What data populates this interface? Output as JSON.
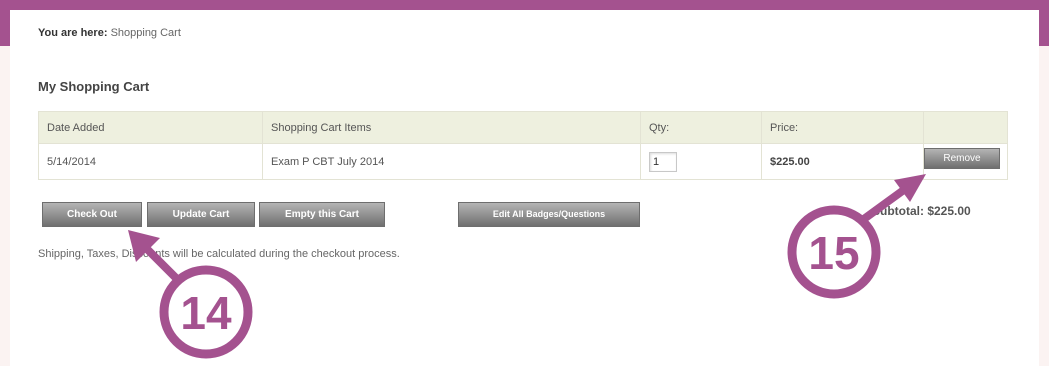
{
  "breadcrumb": {
    "prefix": "You are here:",
    "current": "Shopping Cart"
  },
  "page_title": "My Shopping Cart",
  "table": {
    "headers": [
      "Date Added",
      "Shopping Cart Items",
      "Qty:",
      "Price:",
      ""
    ],
    "rows": [
      {
        "date": "5/14/2014",
        "item": "Exam P CBT July 2014",
        "qty": "1",
        "price": "$225.00",
        "remove_label": "Remove"
      }
    ]
  },
  "buttons": {
    "checkout": "Check Out",
    "update": "Update Cart",
    "empty": "Empty this Cart",
    "edit_all": "Edit All Badges/Questions"
  },
  "subtotal": "Subtotal: $225.00",
  "note": "Shipping, Taxes, Discounts will be calculated during the checkout process.",
  "callouts": [
    {
      "number": "14",
      "color": "#a4528f"
    },
    {
      "number": "15",
      "color": "#a4528f"
    }
  ],
  "colors": {
    "frame": "#a4528f",
    "background": "#fbf3f2",
    "header_row": "#eef0df"
  }
}
